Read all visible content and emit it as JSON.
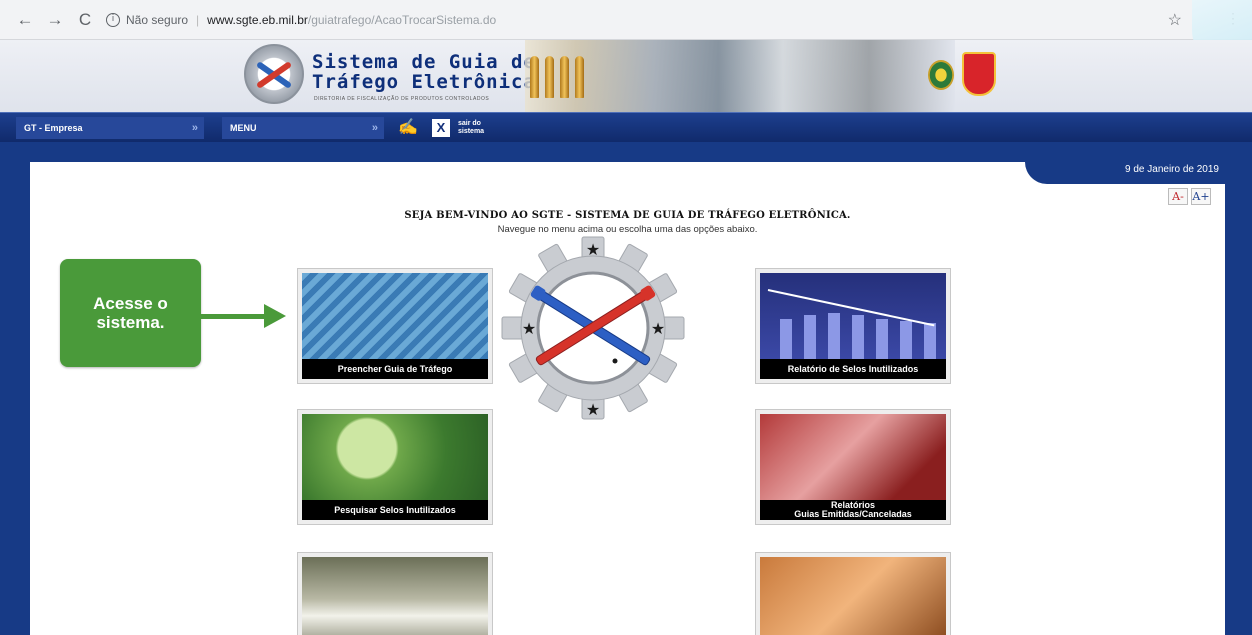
{
  "browser": {
    "back_icon": "←",
    "forward_icon": "→",
    "reload_icon": "C",
    "security_text": "Não seguro",
    "domain": "www.sgte.eb.mil.br",
    "path": "/guiatrafego/AcaoTrocarSistema.do",
    "bookmark_icon": "☆",
    "menu_icon": "⋮"
  },
  "header": {
    "title_line1": "Sistema de Guia de",
    "title_line2": "Tráfego Eletrônica",
    "subtitle": "DIRETORIA DE FISCALIZAÇÃO DE PRODUTOS CONTROLADOS"
  },
  "navbar": {
    "empresa_label": "GT - Empresa",
    "menu_label": "MENU",
    "arrow": "»",
    "exit_icon": "X",
    "exit_label_line1": "sair do",
    "exit_label_line2": "sistema"
  },
  "content": {
    "date": "9 de Janeiro de 2019",
    "font_decrease": "A-",
    "font_increase": "A+",
    "welcome_title": "SEJA BEM-VINDO AO SGTE - SISTEMA DE GUIA DE TRÁFEGO ELETRÔNICA.",
    "welcome_sub": "Navegue no menu acima ou escolha uma das opções abaixo.",
    "tiles": {
      "preencher": "Preencher Guia de Tráfego",
      "relatorio_selos": "Relatório de Selos Inutilizados",
      "pesquisar_selos": "Pesquisar Selos Inutilizados",
      "relatorios_line1": "Relatórios",
      "relatorios_line2": "Guias Emitidas/Canceladas"
    }
  },
  "callout": {
    "line1": "Acesse o",
    "line2": "sistema."
  },
  "colors": {
    "nav_blue": "#173a86",
    "callout_green": "#4a9a3a"
  }
}
